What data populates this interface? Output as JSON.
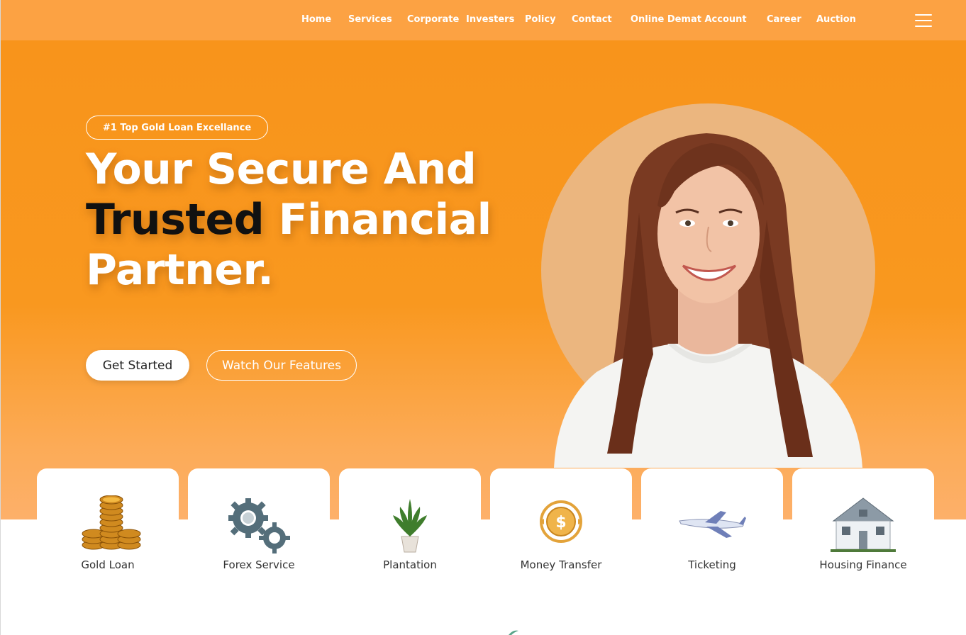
{
  "nav": {
    "items": [
      "Home",
      "Services",
      "Corporate",
      "Investers",
      "Policy",
      "Contact",
      "Online Demat Account",
      "Career",
      "Auction"
    ],
    "menu_icon": "hamburger-menu-icon"
  },
  "hero": {
    "badge": "#1  Top Gold Loan Excellance",
    "headline_part1": "Your Secure And",
    "headline_highlight": "Trusted",
    "headline_part2": " Financial",
    "headline_part3": "Partner.",
    "primary_button": "Get Started",
    "secondary_button": "Watch Our Features"
  },
  "services": [
    {
      "label": "Gold Loan",
      "icon": "gold-coins-icon"
    },
    {
      "label": "Forex Service",
      "icon": "gears-icon"
    },
    {
      "label": "Plantation",
      "icon": "potted-plant-icon"
    },
    {
      "label": "Money Transfer",
      "icon": "dollar-coin-icon"
    },
    {
      "label": "Ticketing",
      "icon": "airplane-icon"
    },
    {
      "label": "Housing Finance",
      "icon": "house-icon"
    }
  ],
  "colors": {
    "brand_orange": "#f8941b",
    "nav_orange": "#fca243",
    "portrait_circle": "#ebb67f",
    "dark_text": "#111111"
  }
}
